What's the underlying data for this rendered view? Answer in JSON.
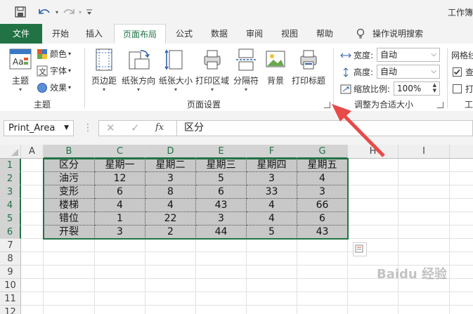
{
  "title_bar": {
    "title": "工作簿"
  },
  "tabs": [
    "文件",
    "开始",
    "插入",
    "页面布局",
    "公式",
    "数据",
    "审阅",
    "视图",
    "帮助"
  ],
  "tell_me": "操作说明搜索",
  "ribbon": {
    "themes_group": {
      "label": "主题",
      "themes_btn": "主题",
      "colors": "颜色",
      "fonts": "字体",
      "effects": "效果"
    },
    "page_setup_group": {
      "label": "页面设置",
      "buttons": [
        "页边距",
        "纸张方向",
        "纸张大小",
        "打印区域",
        "分隔符",
        "背景",
        "打印标题"
      ]
    },
    "scale_group": {
      "label": "调整为合适大小",
      "width_label": "宽度:",
      "width_value": "自动",
      "height_label": "高度:",
      "height_value": "自动",
      "scale_label": "缩放比例:",
      "scale_value": "100%"
    },
    "sheet_options_group": {
      "label_partial": "网格线",
      "view_partial": "查",
      "print_partial": "打",
      "group_partial": "工"
    }
  },
  "formula_bar": {
    "name_box": "Print_Area",
    "fx": "fx",
    "formula": "区分"
  },
  "columns": [
    "A",
    "B",
    "C",
    "D",
    "E",
    "F",
    "G",
    "H",
    "I"
  ],
  "rows": [
    "1",
    "2",
    "3",
    "4",
    "5",
    "6",
    "7",
    "8",
    "9",
    "10",
    "11",
    "12"
  ],
  "table": {
    "header": [
      "区分",
      "星期一",
      "星期二",
      "星期三",
      "星期四",
      "星期五"
    ],
    "rows": [
      [
        "油污",
        "12",
        "3",
        "5",
        "3",
        "4"
      ],
      [
        "变形",
        "6",
        "8",
        "6",
        "33",
        "3"
      ],
      [
        "楼梯",
        "4",
        "4",
        "43",
        "4",
        "66"
      ],
      [
        "错位",
        "1",
        "22",
        "3",
        "4",
        "6"
      ],
      [
        "开裂",
        "3",
        "2",
        "44",
        "5",
        "43"
      ]
    ]
  },
  "watermark": "Baidu 经验"
}
